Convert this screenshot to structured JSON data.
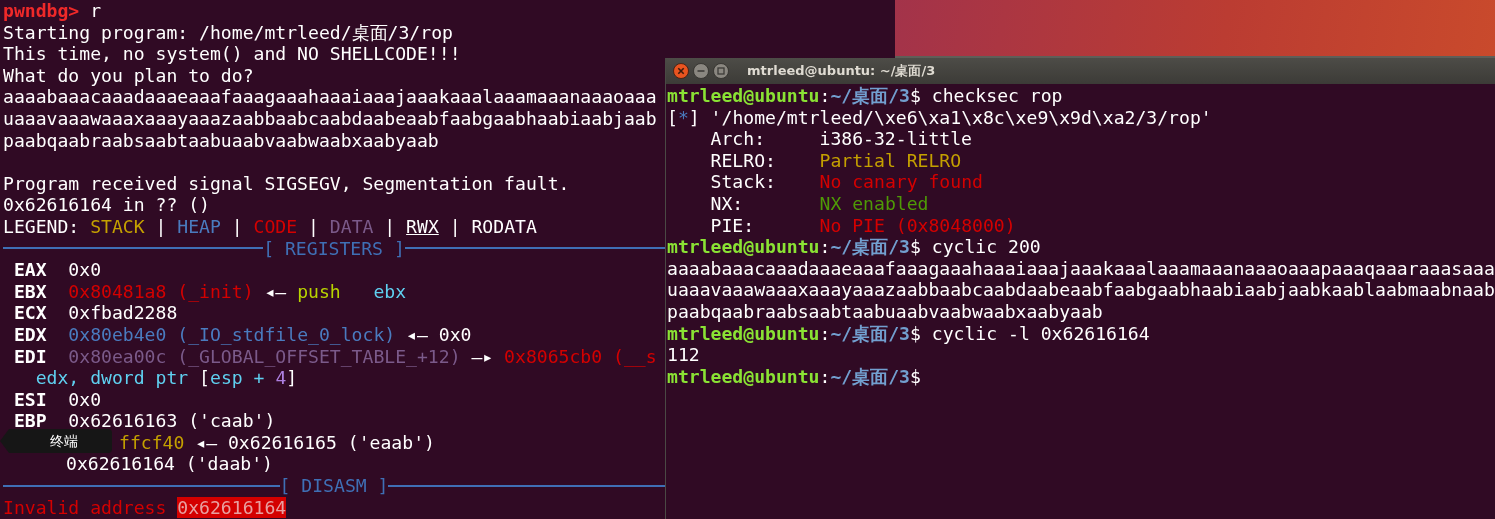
{
  "left_terminal": {
    "lines": [
      {
        "kind": "text",
        "segments": [
          {
            "t": "pwndbg>",
            "kind": "prompt"
          },
          {
            "t": " r",
            "kind": "plain"
          }
        ]
      },
      {
        "kind": "text",
        "segments": [
          {
            "t": "Starting program: /home/mtrleed/桌面/3/rop",
            "kind": "plain"
          }
        ]
      },
      {
        "kind": "text",
        "segments": [
          {
            "t": "This time, no system() and NO SHELLCODE!!!",
            "kind": "plain"
          }
        ]
      },
      {
        "kind": "text",
        "segments": [
          {
            "t": "What do you plan to do?",
            "kind": "plain"
          }
        ]
      },
      {
        "kind": "text",
        "segments": [
          {
            "t": "aaaabaaacaaadaaaeaaafaaagaaahaaaiaaajaaakaaalaaamaaanaaaoaaa",
            "kind": "plain"
          }
        ]
      },
      {
        "kind": "text",
        "segments": [
          {
            "t": "uaaavaaawaaaxaaayaaazaabbaabcaabdaabeaabfaabgaabhaabiaabjaab",
            "kind": "plain"
          }
        ]
      },
      {
        "kind": "text",
        "segments": [
          {
            "t": "paabqaabraabsaabtaabuaabvaabwaabxaabyaab",
            "kind": "plain"
          }
        ]
      },
      {
        "kind": "blank"
      },
      {
        "kind": "text",
        "segments": [
          {
            "t": "Program received signal SIGSEGV, Segmentation fault.",
            "kind": "plain"
          }
        ]
      },
      {
        "kind": "text",
        "segments": [
          {
            "t": "0x62616164 in ?? ()",
            "kind": "plain"
          }
        ]
      },
      {
        "kind": "text",
        "segments": [
          {
            "t": "LEGEND: ",
            "kind": "plain"
          },
          {
            "t": "STACK",
            "kind": "stack"
          },
          {
            "t": " | ",
            "kind": "plain"
          },
          {
            "t": "HEAP",
            "kind": "heap"
          },
          {
            "t": " | ",
            "kind": "plain"
          },
          {
            "t": "CODE",
            "kind": "code"
          },
          {
            "t": " | ",
            "kind": "plain"
          },
          {
            "t": "DATA",
            "kind": "data"
          },
          {
            "t": " | ",
            "kind": "plain"
          },
          {
            "t": "RWX",
            "kind": "rwx"
          },
          {
            "t": " | RODATA",
            "kind": "plain"
          }
        ]
      },
      {
        "kind": "rule",
        "label": "[ REGISTERS ]"
      },
      {
        "kind": "text",
        "segments": [
          {
            "t": " EAX",
            "kind": "reg"
          },
          {
            "t": "  0x0",
            "kind": "plain"
          }
        ]
      },
      {
        "kind": "text",
        "segments": [
          {
            "t": " EBX",
            "kind": "reg"
          },
          {
            "t": "  0x80481a8 (_init)",
            "kind": "code"
          },
          {
            "t": " ◂— ",
            "kind": "plain"
          },
          {
            "t": "push   ",
            "kind": "push"
          },
          {
            "t": "ebx",
            "kind": "cyan"
          }
        ]
      },
      {
        "kind": "text",
        "segments": [
          {
            "t": " ECX",
            "kind": "reg"
          },
          {
            "t": "  0xfbad2288",
            "kind": "plain"
          }
        ]
      },
      {
        "kind": "text",
        "segments": [
          {
            "t": " EDX",
            "kind": "reg"
          },
          {
            "t": "  0x80eb4e0 (_IO_stdfile_0_lock)",
            "kind": "heap"
          },
          {
            "t": " ◂— 0x0",
            "kind": "plain"
          }
        ]
      },
      {
        "kind": "text",
        "segments": [
          {
            "t": " EDI",
            "kind": "reg"
          },
          {
            "t": "  0x80ea00c (_GLOBAL_OFFSET_TABLE_+12)",
            "kind": "data"
          },
          {
            "t": " —▸ ",
            "kind": "plain"
          },
          {
            "t": "0x8065cb0 (__s",
            "kind": "code"
          }
        ]
      },
      {
        "kind": "text",
        "segments": [
          {
            "t": "   edx, dword ptr ",
            "kind": "cyan"
          },
          {
            "t": "[",
            "kind": "plain"
          },
          {
            "t": "esp + ",
            "kind": "cyan"
          },
          {
            "t": "4",
            "kind": "number"
          },
          {
            "t": "]",
            "kind": "plain"
          }
        ]
      },
      {
        "kind": "text",
        "segments": [
          {
            "t": " ESI",
            "kind": "reg"
          },
          {
            "t": "  0x0",
            "kind": "plain"
          }
        ]
      },
      {
        "kind": "text",
        "segments": [
          {
            "t": " EBP",
            "kind": "reg"
          },
          {
            "t": "  0x62616163 ('caab')",
            "kind": "plain"
          }
        ]
      },
      {
        "kind": "covered",
        "segments": [
          {
            "t": "ffcf40",
            "kind": "stack"
          },
          {
            "t": " ◂— 0x62616165 ('eaab')",
            "kind": "plain"
          }
        ]
      },
      {
        "kind": "covered-label",
        "segments": [
          {
            "t": "0x62616164 ('daab')",
            "kind": "plain"
          }
        ]
      },
      {
        "kind": "rule",
        "label": "[ DISASM ]"
      },
      {
        "kind": "text",
        "segments": [
          {
            "t": "Invalid address ",
            "kind": "code"
          },
          {
            "t": "0x62616164",
            "kind": "highlight"
          }
        ]
      }
    ]
  },
  "tooltip": {
    "text": "终端"
  },
  "terminal_window": {
    "title": "mtrleed@ubuntu: ~/桌面/3",
    "lines": [
      {
        "segments": [
          {
            "t": "mtrleed@ubuntu",
            "kind": "user"
          },
          {
            "t": ":",
            "kind": "plain"
          },
          {
            "t": "~/桌面/3",
            "kind": "path"
          },
          {
            "t": "$ checksec rop",
            "kind": "plain"
          }
        ]
      },
      {
        "segments": [
          {
            "t": "[",
            "kind": "plain"
          },
          {
            "t": "*",
            "kind": "heap"
          },
          {
            "t": "] '/home/mtrleed/\\xe6\\xa1\\x8c\\xe9\\x9d\\xa2/3/rop'",
            "kind": "plain"
          }
        ]
      },
      {
        "segments": [
          {
            "t": "    Arch:     i386-32-little",
            "kind": "plain"
          }
        ]
      },
      {
        "segments": [
          {
            "t": "    RELRO:    ",
            "kind": "plain"
          },
          {
            "t": "Partial RELRO",
            "kind": "stack"
          }
        ]
      },
      {
        "segments": [
          {
            "t": "    Stack:    ",
            "kind": "plain"
          },
          {
            "t": "No canary found",
            "kind": "code"
          }
        ]
      },
      {
        "segments": [
          {
            "t": "    NX:       ",
            "kind": "plain"
          },
          {
            "t": "NX enabled",
            "kind": "ok"
          }
        ]
      },
      {
        "segments": [
          {
            "t": "    PIE:      ",
            "kind": "plain"
          },
          {
            "t": "No PIE (0x8048000)",
            "kind": "code"
          }
        ]
      },
      {
        "segments": [
          {
            "t": "mtrleed@ubuntu",
            "kind": "user"
          },
          {
            "t": ":",
            "kind": "plain"
          },
          {
            "t": "~/桌面/3",
            "kind": "path"
          },
          {
            "t": "$ cyclic 200",
            "kind": "plain"
          }
        ]
      },
      {
        "segments": [
          {
            "t": "aaaabaaacaaadaaaeaaafaaagaaahaaaiaaajaaakaaalaaamaaanaaaoaaapaaaqaaaraaasaaa",
            "kind": "plain"
          }
        ]
      },
      {
        "segments": [
          {
            "t": "uaaavaaawaaaxaaayaaazaabbaabcaabdaabeaabfaabgaabhaabiaabjaabkaablaabmaabnaab",
            "kind": "plain"
          }
        ]
      },
      {
        "segments": [
          {
            "t": "paabqaabraabsaabtaabuaabvaabwaabxaabyaab",
            "kind": "plain"
          }
        ]
      },
      {
        "segments": [
          {
            "t": "mtrleed@ubuntu",
            "kind": "user"
          },
          {
            "t": ":",
            "kind": "plain"
          },
          {
            "t": "~/桌面/3",
            "kind": "path"
          },
          {
            "t": "$ cyclic -l 0x62616164",
            "kind": "plain"
          }
        ]
      },
      {
        "segments": [
          {
            "t": "112",
            "kind": "plain"
          }
        ]
      },
      {
        "segments": [
          {
            "t": "mtrleed@ubuntu",
            "kind": "user"
          },
          {
            "t": ":",
            "kind": "plain"
          },
          {
            "t": "~/桌面/3",
            "kind": "path"
          },
          {
            "t": "$",
            "kind": "plain"
          }
        ]
      }
    ]
  }
}
